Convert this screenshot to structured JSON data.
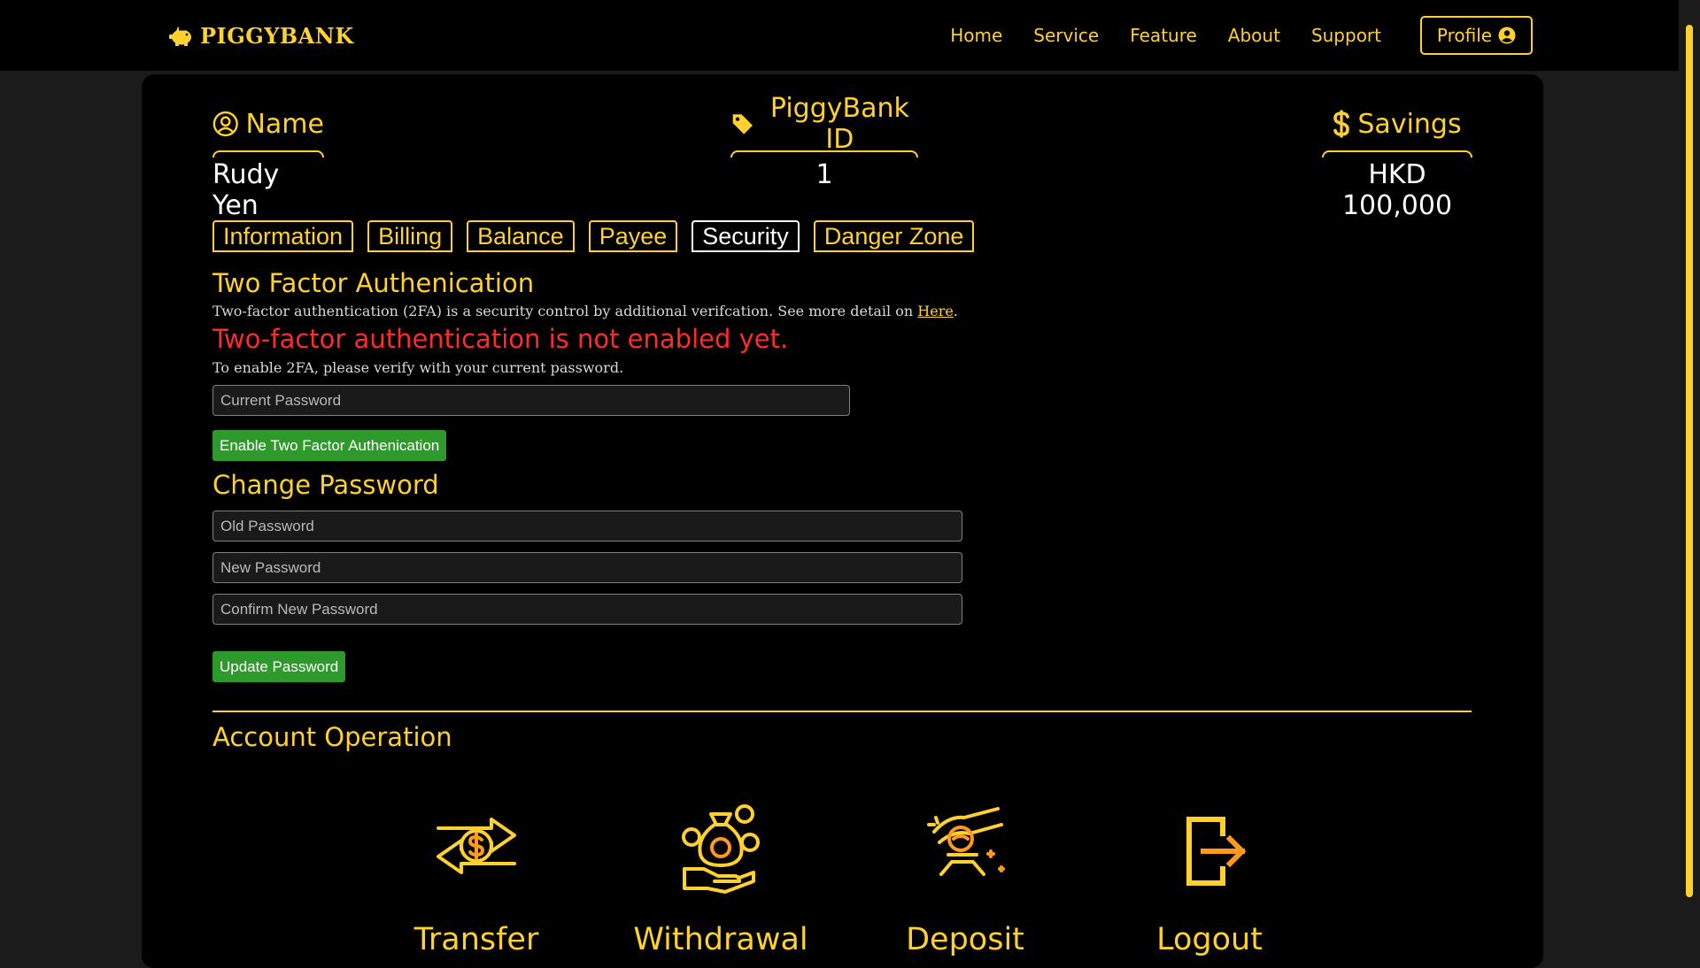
{
  "brand": {
    "name": "PIGGYBANK",
    "icon": "piggy-bank-icon"
  },
  "nav": {
    "links": [
      "Home",
      "Service",
      "Feature",
      "About",
      "Support"
    ],
    "profile_label": "Profile",
    "profile_icon": "user-circle-icon"
  },
  "account": {
    "name_label": "Name",
    "name_value": "Rudy Yen",
    "id_label": "PiggyBank ID",
    "id_value": "1",
    "savings_label": "Savings",
    "savings_value": "HKD 100,000"
  },
  "tabs": {
    "items": [
      "Information",
      "Billing",
      "Balance",
      "Payee",
      "Security",
      "Danger Zone"
    ],
    "active": "Security"
  },
  "security": {
    "tfa_title": "Two Factor Authenication",
    "tfa_desc": "Two-factor authentication (2FA) is a security control by additional verifcation. See more detail on",
    "tfa_link": "Here",
    "tfa_desc_end": ".",
    "tfa_status": "Two-factor authentication is not enabled yet.",
    "tfa_hint": "To enable 2FA, please verify with your current password.",
    "current_password_placeholder": "Current Password",
    "enable_button": "Enable Two Factor Authenication",
    "change_title": "Change Password",
    "old_password_placeholder": "Old Password",
    "new_password_placeholder": "New Password",
    "confirm_password_placeholder": "Confirm New Password",
    "update_button": "Update Password"
  },
  "operations": {
    "title": "Account Operation",
    "items": [
      {
        "label": "Transfer",
        "icon": "transfer-icon"
      },
      {
        "label": "Withdrawal",
        "icon": "withdrawal-icon"
      },
      {
        "label": "Deposit",
        "icon": "deposit-icon"
      },
      {
        "label": "Logout",
        "icon": "logout-icon"
      }
    ]
  },
  "colors": {
    "accent": "#ffd12f",
    "background": "#000000",
    "page_background": "#1b1b1b",
    "alert": "#ff2a2a",
    "button_green": "#2d9a2b"
  }
}
